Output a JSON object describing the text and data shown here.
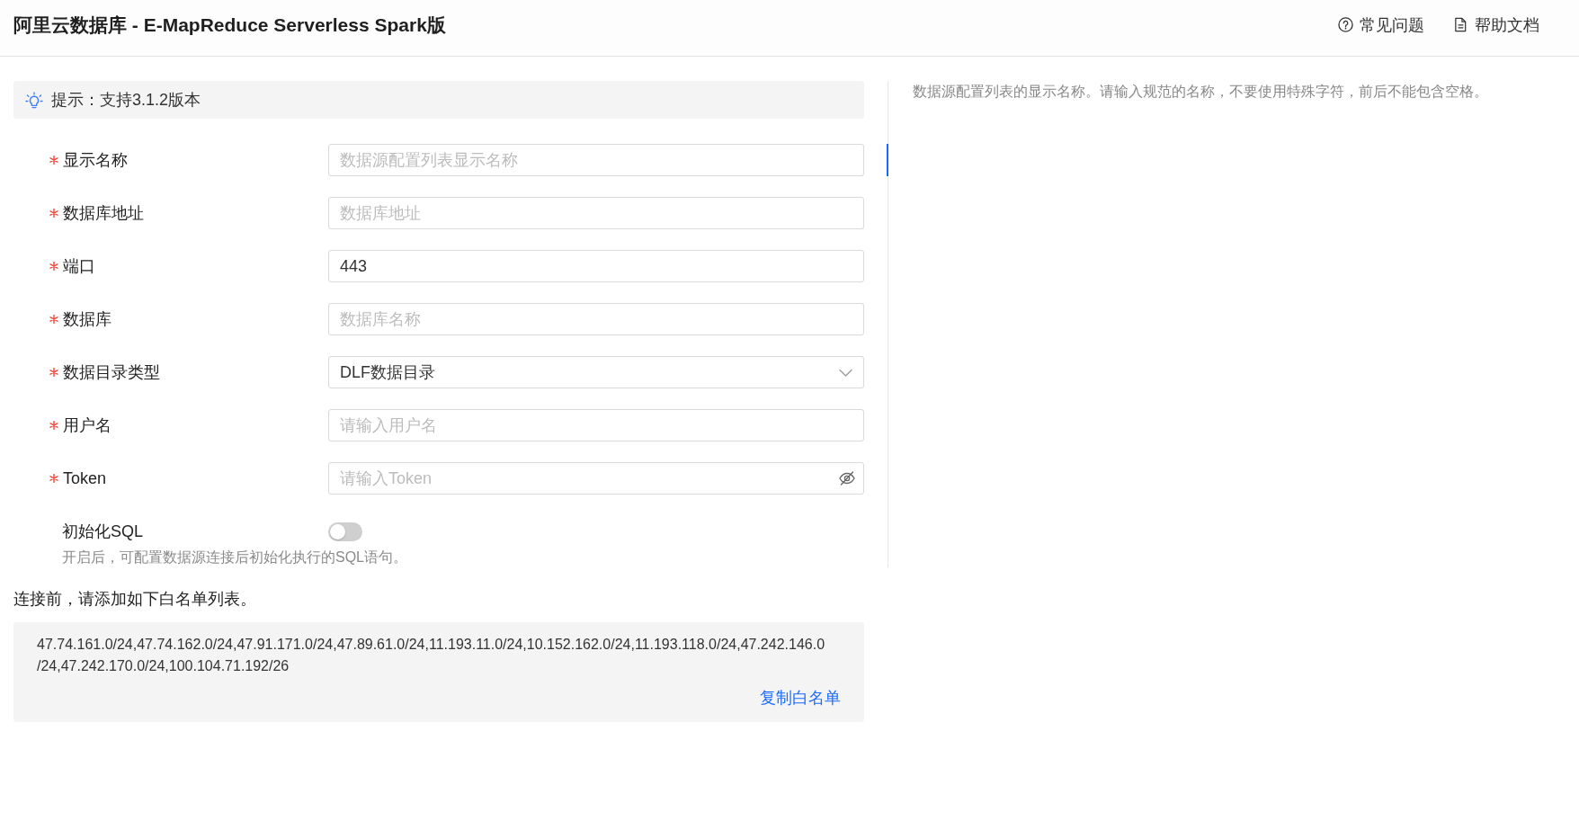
{
  "header": {
    "title": "阿里云数据库 - E-MapReduce Serverless Spark版",
    "links": [
      {
        "label": "常见问题"
      },
      {
        "label": "帮助文档"
      }
    ]
  },
  "hint": {
    "text": "提示：支持3.1.2版本"
  },
  "fields": [
    {
      "label": "显示名称",
      "required": true,
      "kind": "input",
      "placeholder": "数据源配置列表显示名称",
      "selected": true
    },
    {
      "label": "数据库地址",
      "required": true,
      "kind": "input",
      "placeholder": "数据库地址",
      "selected": false
    },
    {
      "label": "端口",
      "required": true,
      "kind": "input",
      "value": "443",
      "selected": false
    },
    {
      "label": "数据库",
      "required": true,
      "kind": "input",
      "placeholder": "数据库名称",
      "selected": false
    },
    {
      "label": "数据目录类型",
      "required": true,
      "kind": "select",
      "value": "DLF数据目录",
      "selected": false
    },
    {
      "label": "用户名",
      "required": true,
      "kind": "input",
      "placeholder": "请输入用户名",
      "selected": false
    },
    {
      "label": "Token",
      "required": true,
      "kind": "password",
      "placeholder": "请输入Token",
      "selected": false
    }
  ],
  "init_sql": {
    "label": "初始化SQL",
    "on": false,
    "description": "开启后，可配置数据源连接后初始化执行的SQL语句。"
  },
  "help": {
    "text": "数据源配置列表的显示名称。请输入规范的名称，不要使用特殊字符，前后不能包含空格。"
  },
  "whitelist": {
    "intro": "连接前，请添加如下白名单列表。",
    "ips": "47.74.161.0/24,47.74.162.0/24,47.91.171.0/24,47.89.61.0/24,11.193.11.0/24,10.152.162.0/24,11.193.118.0/24,47.242.146.0/24,47.242.170.0/24,100.104.71.192/26",
    "copy_link": "复制白名单"
  }
}
